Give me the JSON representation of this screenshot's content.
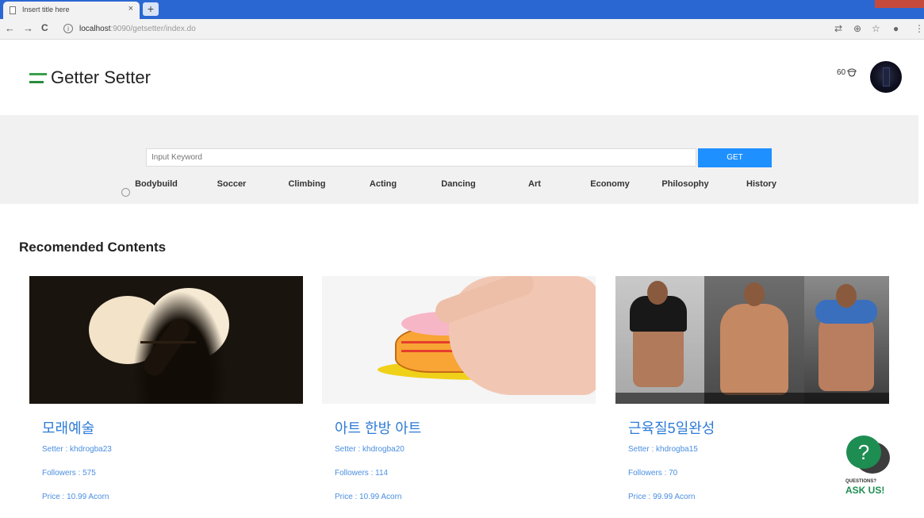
{
  "browser": {
    "tab_title": "Insert title here",
    "tab_close": "×",
    "new_tab": "+",
    "url_host": "localhost",
    "url_path": ":9090/getsetter/index.do",
    "nav": {
      "back": "←",
      "forward": "→",
      "reload": "C"
    }
  },
  "header": {
    "logo_text": "Getter Setter",
    "acorn_count": "60"
  },
  "search": {
    "placeholder": "Input Keyword",
    "button_label": "GET"
  },
  "categories": [
    "Bodybuild",
    "Soccer",
    "Climbing",
    "Acting",
    "Dancing",
    "Art",
    "Economy",
    "Philosophy",
    "History"
  ],
  "section_title": "Recomended Contents",
  "cards": [
    {
      "title": "모래예술",
      "setter": "Setter : khdrogba23",
      "followers": "Followers : 575",
      "price": "Price : 10.99 Acorn"
    },
    {
      "title": "아트 한방 아트",
      "setter": "Setter : khdrogba20",
      "followers": "Followers : 114",
      "price": "Price : 10.99 Acorn"
    },
    {
      "title": "근육질5일완성",
      "setter": "Setter : khdrogba15",
      "followers": "Followers : 70",
      "price": "Price : 99.99 Acorn"
    }
  ],
  "help_widget": {
    "icon": "?",
    "small_label": "QUESTIONS?",
    "big_label": "ASK US!"
  },
  "colors": {
    "brand_green": "#1e8d51",
    "button_blue": "#1e90ff",
    "link_blue": "#2e7bd6"
  }
}
